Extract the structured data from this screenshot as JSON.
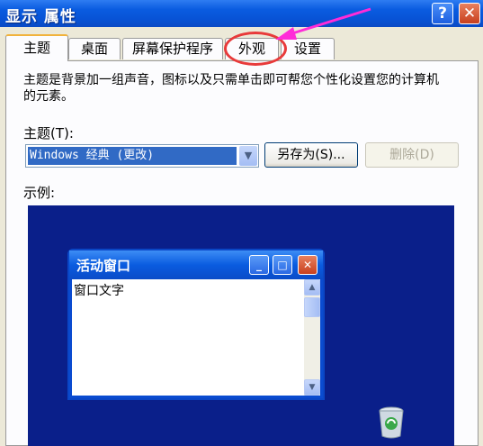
{
  "window": {
    "title": "显示 属性",
    "help_label": "?",
    "close_label": "✕"
  },
  "tabs": [
    {
      "label": "主题",
      "active": true
    },
    {
      "label": "桌面",
      "active": false
    },
    {
      "label": "屏幕保护程序",
      "active": false
    },
    {
      "label": "外观",
      "active": false
    },
    {
      "label": "设置",
      "active": false
    }
  ],
  "theme_page": {
    "description": "主题是背景加一组声音，图标以及只需单击即可帮您个性化设置您的计算机的元素。",
    "theme_label": "主题(T):",
    "theme_value": "Windows 经典 (更改)",
    "save_as_label": "另存为(S)...",
    "delete_label": "删除(D)",
    "example_label": "示例:"
  },
  "preview": {
    "active_window_title": "活动窗口",
    "window_text": "窗口文字",
    "minimize_icon": "minimize-icon",
    "maximize_icon": "maximize-icon",
    "close_icon": "close-icon",
    "desktop_icon": "recycle-bin-icon",
    "desktop_color": "#0a1f8a"
  },
  "annotation": {
    "highlight_color": "#e83a3a",
    "arrow_color": "#ff2bd8"
  }
}
